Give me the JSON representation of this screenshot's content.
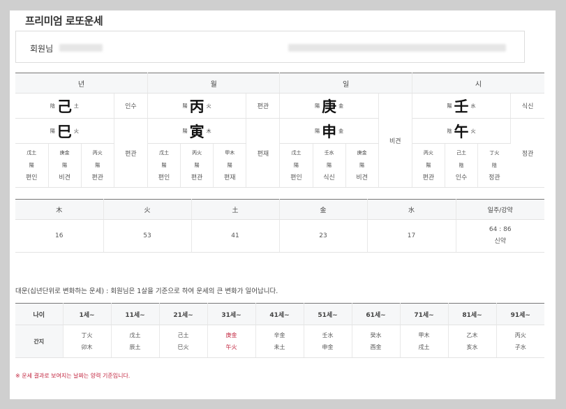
{
  "page": {
    "title": "프리미엄 로또운세"
  },
  "member": {
    "label": "회원님"
  },
  "saju": {
    "headers": [
      "년",
      "월",
      "일",
      "시"
    ],
    "stems": [
      {
        "yin": "陰",
        "char": "己",
        "elem": "土",
        "rel": "인수"
      },
      {
        "yin": "陽",
        "char": "丙",
        "elem": "火",
        "rel": "편관"
      },
      {
        "yin": "陽",
        "char": "庚",
        "elem": "金",
        "rel": ""
      },
      {
        "yin": "陽",
        "char": "壬",
        "elem": "水",
        "rel": "식신"
      }
    ],
    "branches": [
      {
        "yin": "陽",
        "char": "巳",
        "elem": "火"
      },
      {
        "yin": "陽",
        "char": "寅",
        "elem": "木"
      },
      {
        "yin": "陽",
        "char": "申",
        "elem": "金"
      },
      {
        "yin": "陰",
        "char": "午",
        "elem": "火"
      }
    ],
    "branch_rel": [
      "편관",
      "편재",
      "비견",
      "정관"
    ],
    "hidden": [
      [
        {
          "a": "戊土",
          "b": "陽",
          "c": "편인"
        },
        {
          "a": "庚金",
          "b": "陽",
          "c": "비견"
        },
        {
          "a": "丙火",
          "b": "陽",
          "c": "편관"
        }
      ],
      [
        {
          "a": "戊土",
          "b": "陽",
          "c": "편인"
        },
        {
          "a": "丙火",
          "b": "陽",
          "c": "편관"
        },
        {
          "a": "甲木",
          "b": "陽",
          "c": "편재"
        }
      ],
      [
        {
          "a": "戊土",
          "b": "陽",
          "c": "편인"
        },
        {
          "a": "壬水",
          "b": "陽",
          "c": "식신"
        },
        {
          "a": "庚金",
          "b": "陽",
          "c": "비견"
        }
      ],
      [
        {
          "a": "丙火",
          "b": "陽",
          "c": "편관"
        },
        {
          "a": "己土",
          "b": "陰",
          "c": "인수"
        },
        {
          "a": "丁火",
          "b": "陰",
          "c": "정관"
        }
      ]
    ]
  },
  "elements": {
    "headers": [
      "木",
      "火",
      "土",
      "金",
      "水",
      "일주/강약"
    ],
    "values": [
      "16",
      "53",
      "41",
      "23",
      "17"
    ],
    "ratio": "64 : 86",
    "strength": "신약"
  },
  "daeun": {
    "description": "대운(십년단위로 변화하는 운세) : 회원님은 1살을 기준으로 하여 운세의 큰 변화가 일어납니다.",
    "age_label": "나이",
    "ganji_label": "간지",
    "ages": [
      "1세~",
      "11세~",
      "21세~",
      "31세~",
      "41세~",
      "51세~",
      "61세~",
      "71세~",
      "81세~",
      "91세~"
    ],
    "ganji": [
      {
        "top": "丁火",
        "bottom": "卯木",
        "highlight": false
      },
      {
        "top": "戊土",
        "bottom": "辰土",
        "highlight": false
      },
      {
        "top": "己土",
        "bottom": "巳火",
        "highlight": false
      },
      {
        "top": "庚金",
        "bottom": "午火",
        "highlight": true
      },
      {
        "top": "辛金",
        "bottom": "未土",
        "highlight": false
      },
      {
        "top": "壬水",
        "bottom": "申金",
        "highlight": false
      },
      {
        "top": "癸水",
        "bottom": "酉金",
        "highlight": false
      },
      {
        "top": "甲木",
        "bottom": "戌土",
        "highlight": false
      },
      {
        "top": "乙木",
        "bottom": "亥水",
        "highlight": false
      },
      {
        "top": "丙火",
        "bottom": "子水",
        "highlight": false
      }
    ]
  },
  "note": "※ 운세 결과로 보여지는 날짜는 양력 기준입니다.",
  "colors": {
    "accent_red": "#c0213b",
    "header_bg": "#f6f7f8"
  }
}
